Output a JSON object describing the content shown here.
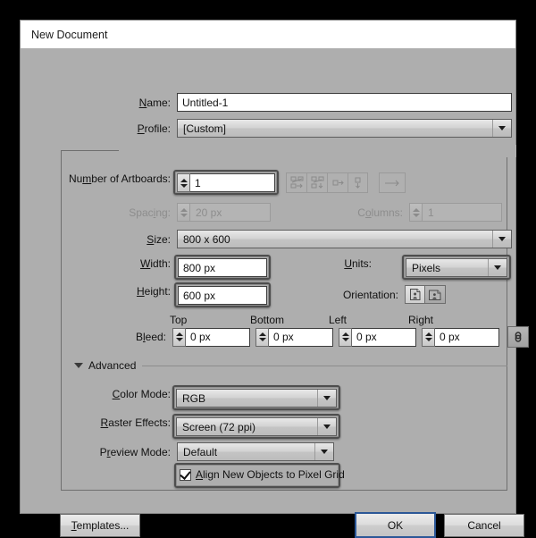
{
  "window": {
    "title": "New Document"
  },
  "fields": {
    "name": {
      "label": "Name:",
      "value": "Untitled-1"
    },
    "profile": {
      "label": "Profile:",
      "value": "[Custom]"
    },
    "artboards": {
      "label": "Number of Artboards:",
      "value": "1"
    },
    "spacing": {
      "label": "Spacing:",
      "value": "20 px"
    },
    "columns": {
      "label": "Columns:",
      "value": "1"
    },
    "size": {
      "label": "Size:",
      "value": "800 x 600"
    },
    "width": {
      "label": "Width:",
      "value": "800 px"
    },
    "height": {
      "label": "Height:",
      "value": "600 px"
    },
    "units": {
      "label": "Units:",
      "value": "Pixels"
    },
    "orientation": {
      "label": "Orientation:"
    },
    "bleed": {
      "label": "Bleed:",
      "top_header": "Top",
      "bottom_header": "Bottom",
      "left_header": "Left",
      "right_header": "Right",
      "top": "0 px",
      "bottom": "0 px",
      "left": "0 px",
      "right": "0 px"
    }
  },
  "advanced": {
    "label": "Advanced",
    "color_mode": {
      "label": "Color Mode:",
      "value": "RGB"
    },
    "raster_effects": {
      "label": "Raster Effects:",
      "value": "Screen (72 ppi)"
    },
    "preview_mode": {
      "label": "Preview Mode:",
      "value": "Default"
    },
    "align_pixel_grid": {
      "label": "Align New Objects to Pixel Grid",
      "checked": true
    }
  },
  "buttons": {
    "templates": "Templates...",
    "ok": "OK",
    "cancel": "Cancel"
  },
  "icons": {
    "arrange_grid_row": "grid-by-row-icon",
    "arrange_grid_column": "grid-by-column-icon",
    "arrange_row": "arrange-in-row-icon",
    "arrange_column": "arrange-in-column-icon",
    "direction": "left-to-right-icon",
    "orientation_portrait": "portrait-icon",
    "orientation_landscape": "landscape-icon",
    "bleed_link": "link-chain-icon",
    "twisty": "chevron-down-icon"
  },
  "colors": {
    "dialog_bg": "#aeaeae",
    "titlebar_bg": "#ffffff",
    "focus_blue": "#2b5797",
    "ring": "#4e4e4e"
  }
}
